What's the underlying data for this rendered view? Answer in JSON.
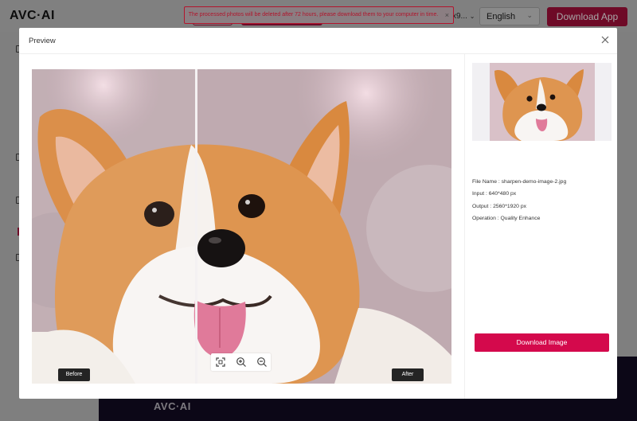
{
  "header": {
    "logo": "AVC·AI",
    "account_label": "x9...",
    "language": "English",
    "download_app": "Download App"
  },
  "toast": {
    "message": "The processed photos will be deleted after 72 hours, please download them to your computer in time.",
    "close_glyph": "×"
  },
  "modal": {
    "title": "Preview",
    "before_label": "Before",
    "after_label": "After",
    "info": {
      "file_name": "File Name : sharpen-demo-image-2.jpg",
      "input": "Input : 640*480 px",
      "output": "Output : 2560*1920 px",
      "operation": "Operation : Quality Enhance"
    },
    "download_button": "Download Image"
  },
  "footer": {
    "logo": "AVC·AI"
  },
  "colors": {
    "brand": "#d4094c",
    "overlay": "#7f7f7f",
    "footer_bg": "#0c0717"
  },
  "icons": [
    "close-icon",
    "fit-screen-icon",
    "zoom-in-icon",
    "zoom-out-icon",
    "chevron-down-icon"
  ]
}
